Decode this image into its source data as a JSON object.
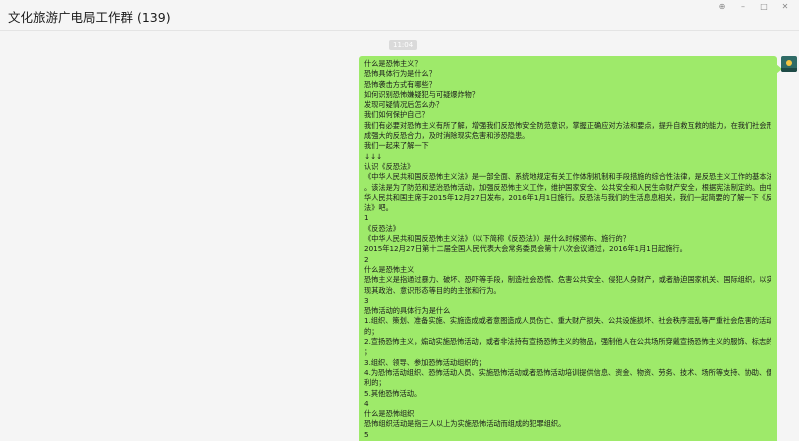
{
  "window": {
    "title": "文化旅游广电局工作群 (139)",
    "controls": {
      "pin_icon": "pin-icon",
      "minimize_icon": "minimize-icon",
      "maximize_icon": "maximize-icon",
      "close_icon": "close-icon"
    }
  },
  "chat": {
    "timestamp": "11:04",
    "bubble_color": "#9eea6a",
    "message_lines": [
      "什么是恐怖主义？",
      "恐怖具体行为是什么？",
      "恐怖袭击方式有哪些？",
      "如何识别恐怖嫌疑犯与可疑爆炸物？",
      "发现可疑情况后怎么办？",
      "我们如何保护自己？",
      "我们有必要对恐怖主义有所了解，增强我们反恐怖安全防范意识，掌握正确应对方法和要点，提升自救互救的能力，在我们社会形",
      "成强大的反恐合力，及时消除现实危害和涉恐隐患。",
      "我们一起来了解一下",
      "↓↓↓",
      "认识《反恐法》",
      "《中华人民共和国反恐怖主义法》是一部全面、系统地规定有关工作体制机制和手段措施的综合性法律，是反恐主义工作的基本法",
      "。该法是为了防范和惩治恐怖活动，加强反恐怖主义工作，维护国家安全、公共安全和人民生命财产安全，根据宪法制定的。由中",
      "华人民共和国主席于2015年12月27日发布，2016年1月1日施行。反恐法与我们的生活息息相关，我们一起简要的了解一下《反恐",
      "法》吧。",
      "1",
      "《反恐法》",
      "《中华人民共和国反恐怖主义法》（以下简称《反恐法》）是什么时候颁布、施行的？",
      "2015年12月27日第十二届全国人民代表大会常务委员会第十八次会议通过，2016年1月1日起施行。",
      "2",
      "什么是恐怖主义",
      "恐怖主义是指通过暴力、破坏、恐吓等手段，制造社会恐慌、危害公共安全、侵犯人身财产，或者胁迫国家机关、国际组织，以实",
      "现其政治、意识形态等目的的主张和行为。",
      "3",
      "恐怖活动的具体行为是什么",
      "1.组织、策划、准备实施、实施造成或者意图造成人员伤亡、重大财产损失、公共设施损坏、社会秩序混乱等严重社会危害的活动",
      "的；",
      "2.宣扬恐怖主义，煽动实施恐怖活动，或者非法持有宣扬恐怖主义的物品，强制他人在公共场所穿戴宣扬恐怖主义的服饰、标志的",
      "；",
      "3.组织、领导、参加恐怖活动组织的；",
      "4.为恐怖活动组织、恐怖活动人员、实施恐怖活动或者恐怖活动培训提供信息、资金、物资、劳务、技术、场所等支持、协助、便",
      "利的；",
      "5.其他恐怖活动。",
      "4",
      "什么是恐怖组织",
      "恐怖组织活动是指三人以上为实施恐怖活动而组成的犯罪组织。",
      "5"
    ]
  }
}
